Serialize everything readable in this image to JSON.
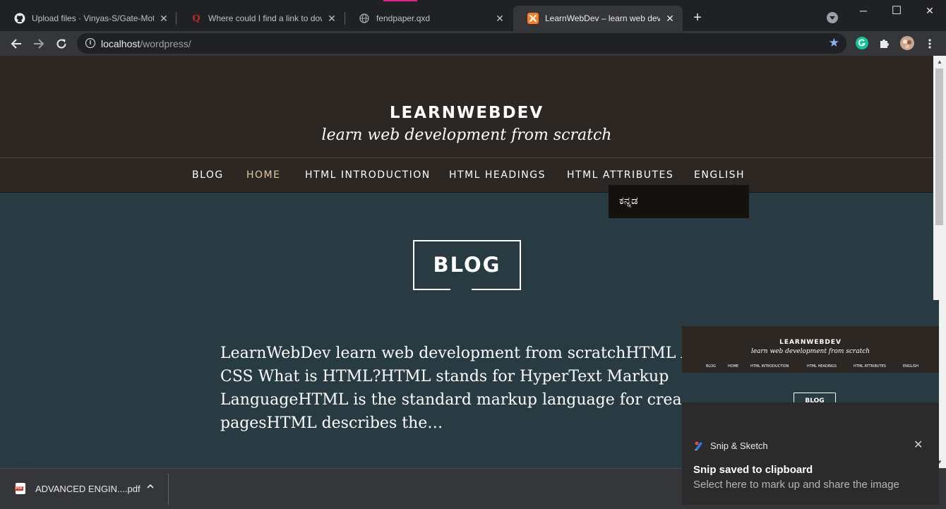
{
  "browser": {
    "tabs": [
      {
        "title": "Upload files · Vinyas-S/Gate-Mot",
        "icon": "github-icon"
      },
      {
        "title": "Where could I find a link to down",
        "icon": "quora-icon"
      },
      {
        "title": "fendpaper.qxd",
        "icon": "globe-icon"
      },
      {
        "title": "LearnWebDev – learn web develo",
        "icon": "xampp-icon"
      }
    ],
    "new_tab": "+",
    "window_controls": {
      "minimize": "─",
      "maximize": "☐",
      "close": "✕"
    },
    "address": {
      "host": "localhost",
      "path": "/wordpress/"
    }
  },
  "site": {
    "title": "LEARNWEBDEV",
    "description": "learn web development from scratch",
    "nav": [
      {
        "label": "BLOG"
      },
      {
        "label": "HOME",
        "current": true
      },
      {
        "label": "HTML INTRODUCTION"
      },
      {
        "label": "HTML HEADINGS"
      },
      {
        "label": "HTML ATTRIBUTES"
      },
      {
        "label": "ENGLISH"
      }
    ],
    "submenu": [
      "ಕನ್ನಡ"
    ],
    "page_title": "BLOG",
    "excerpt": "LearnWebDev learn web development from scratchHTML AND\nCSS What is HTML?HTML stands for HyperText Markup\nLanguageHTML is the standard markup language for creating We\npagesHTML describes the…"
  },
  "download": {
    "filename": "ADVANCED ENGIN....pdf",
    "caret": "^"
  },
  "toast": {
    "app": "Snip & Sketch",
    "heading": "Snip saved to clipboard",
    "body": "Select here to mark up and share the image",
    "close": "✕"
  },
  "colors": {
    "header_bg": "#2c2722",
    "content_bg": "#283b42",
    "nav_current": "#e1c8a8",
    "chrome_bg": "#202124",
    "toolbar_bg": "#35363a"
  }
}
